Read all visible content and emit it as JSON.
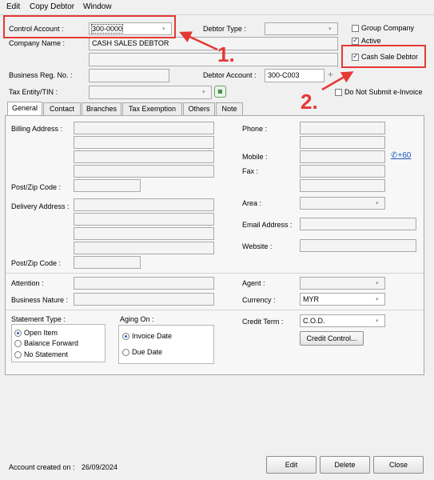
{
  "menu": [
    "Edit",
    "Copy Debtor",
    "Window"
  ],
  "header": {
    "control_account_label": "Control Account :",
    "control_account_value": "300-0000",
    "company_name_label": "Company Name :",
    "company_name_value": "CASH SALES DEBTOR",
    "business_reg_label": "Business Reg. No. :",
    "tax_entity_label": "Tax Entity/TIN :",
    "debtor_type_label": "Debtor Type :",
    "debtor_account_label": "Debtor Account :",
    "debtor_account_value": "300-C003",
    "group_company_label": "Group Company",
    "active_label": "Active",
    "cash_sale_debtor_label": "Cash Sale Debtor",
    "no_einvoice_label": "Do Not Submit e-Invoice"
  },
  "checkbox_states": {
    "group_company": false,
    "active": true,
    "cash_sale_debtor": true,
    "no_einvoice": false
  },
  "annotations": {
    "one": "1.",
    "two": "2."
  },
  "tabs": [
    "General",
    "Contact",
    "Branches",
    "Tax Exemption",
    "Others",
    "Note"
  ],
  "general": {
    "billing_address_label": "Billing Address :",
    "post_zip_label": "Post/Zip Code :",
    "delivery_address_label": "Delivery Address :",
    "phone_label": "Phone :",
    "mobile_label": "Mobile :",
    "mobile_link": "+60",
    "fax_label": "Fax :",
    "area_label": "Area :",
    "email_label": "Email  Address :",
    "website_label": "Website :",
    "attention_label": "Attention :",
    "business_nature_label": "Business Nature :",
    "agent_label": "Agent :",
    "currency_label": "Currency :",
    "currency_value": "MYR",
    "statement_type_label": "Statement Type :",
    "statement_options": [
      "Open Item",
      "Balance Forward",
      "No Statement"
    ],
    "aging_on_label": "Aging On :",
    "aging_options": [
      "Invoice Date",
      "Due Date"
    ],
    "credit_term_label": "Credit Term :",
    "credit_term_value": "C.O.D.",
    "credit_control_button": "Credit Control..."
  },
  "footer": {
    "account_created_label": "Account created on :",
    "account_created_date": "26/09/2024",
    "edit_button": "Edit",
    "delete_button": "Delete",
    "close_button": "Close"
  },
  "colors": {
    "annotation": "#e53935",
    "link": "#1a56c4",
    "selected_text_bg": "#2b62c9"
  }
}
